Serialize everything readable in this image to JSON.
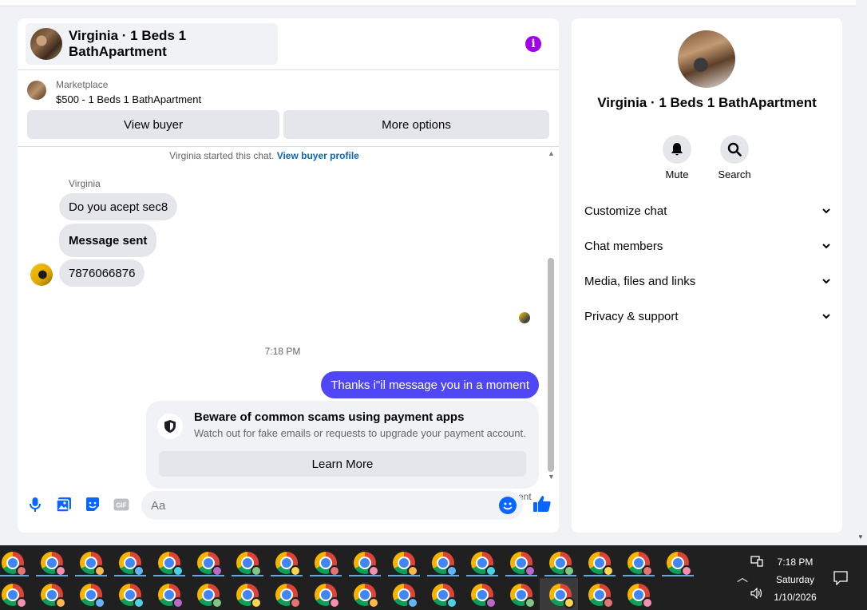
{
  "chat": {
    "title": "Virginia · 1 Beds 1 BathApartment",
    "marketplace_label": "Marketplace",
    "listing": "$500 - 1 Beds 1 BathApartment",
    "view_buyer": "View buyer",
    "more_options": "More options",
    "started_text": "Virginia started this chat.",
    "view_profile_link": "View buyer profile",
    "sender_name": "Virginia",
    "messages_in": [
      "Do you acept sec8",
      "Message sent",
      "7876066876"
    ],
    "time_separator": "7:18 PM",
    "message_out": "Thanks i\"il message you in a moment",
    "scam_title": "Beware of common scams using payment apps",
    "scam_sub": "Watch out for fake emails or requests to upgrade your payment account.",
    "learn_more": "Learn More",
    "sent_status": "Sent",
    "composer_placeholder": "Aa",
    "accent": "#4f46f5",
    "info_color": "#a200e8"
  },
  "info_panel": {
    "title": "Virginia · 1 Beds 1 BathApartment",
    "actions": [
      {
        "label": "Mute",
        "icon": "bell-icon"
      },
      {
        "label": "Search",
        "icon": "search-icon"
      }
    ],
    "sections": [
      "Customize chat",
      "Chat members",
      "Media, files and links",
      "Privacy & support"
    ]
  },
  "taskbar": {
    "time": "7:18 PM",
    "day": "Saturday",
    "date": "1/10/2026"
  }
}
